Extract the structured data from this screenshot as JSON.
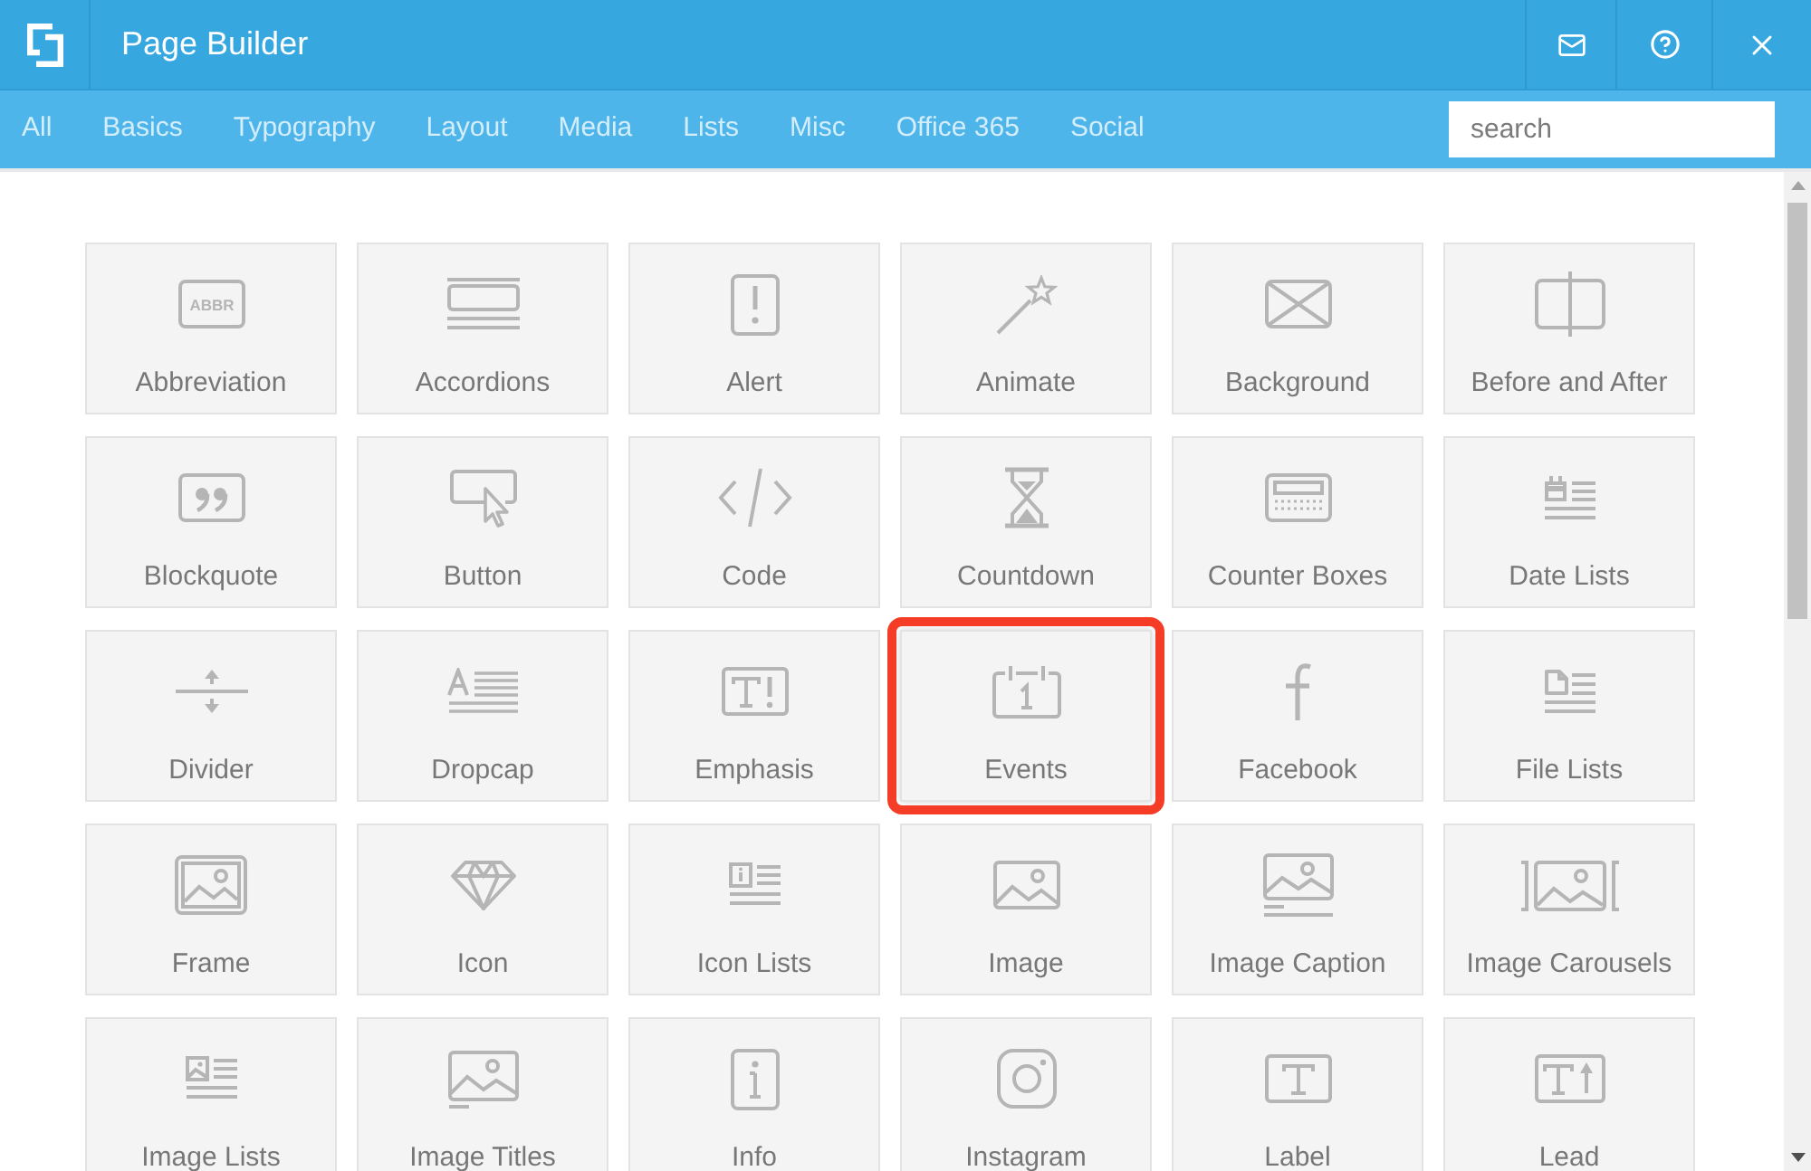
{
  "window": {
    "title": "Page Builder"
  },
  "tabs": [
    {
      "label": "All"
    },
    {
      "label": "Basics"
    },
    {
      "label": "Typography"
    },
    {
      "label": "Layout"
    },
    {
      "label": "Media"
    },
    {
      "label": "Lists"
    },
    {
      "label": "Misc"
    },
    {
      "label": "Office 365"
    },
    {
      "label": "Social"
    }
  ],
  "search": {
    "placeholder": "search"
  },
  "tiles": [
    {
      "label": "Abbreviation",
      "icon_text": "ABBR",
      "highlighted": false
    },
    {
      "label": "Accordions",
      "highlighted": false
    },
    {
      "label": "Alert",
      "highlighted": false
    },
    {
      "label": "Animate",
      "highlighted": false
    },
    {
      "label": "Background",
      "highlighted": false
    },
    {
      "label": "Before and After",
      "highlighted": false
    },
    {
      "label": "Blockquote",
      "highlighted": false
    },
    {
      "label": "Button",
      "highlighted": false
    },
    {
      "label": "Code",
      "highlighted": false
    },
    {
      "label": "Countdown",
      "highlighted": false
    },
    {
      "label": "Counter Boxes",
      "highlighted": false
    },
    {
      "label": "Date Lists",
      "highlighted": false
    },
    {
      "label": "Divider",
      "highlighted": false
    },
    {
      "label": "Dropcap",
      "highlighted": false
    },
    {
      "label": "Emphasis",
      "highlighted": false
    },
    {
      "label": "Events",
      "highlighted": true
    },
    {
      "label": "Facebook",
      "highlighted": false
    },
    {
      "label": "File Lists",
      "highlighted": false
    },
    {
      "label": "Frame",
      "highlighted": false
    },
    {
      "label": "Icon",
      "highlighted": false
    },
    {
      "label": "Icon Lists",
      "highlighted": false
    },
    {
      "label": "Image",
      "highlighted": false
    },
    {
      "label": "Image Caption",
      "highlighted": false
    },
    {
      "label": "Image Carousels",
      "highlighted": false
    },
    {
      "label": "Image Lists",
      "highlighted": false
    },
    {
      "label": "Image Titles",
      "highlighted": false
    },
    {
      "label": "Info",
      "highlighted": false
    },
    {
      "label": "Instagram",
      "highlighted": false
    },
    {
      "label": "Label",
      "highlighted": false
    },
    {
      "label": "Lead",
      "highlighted": false
    }
  ]
}
